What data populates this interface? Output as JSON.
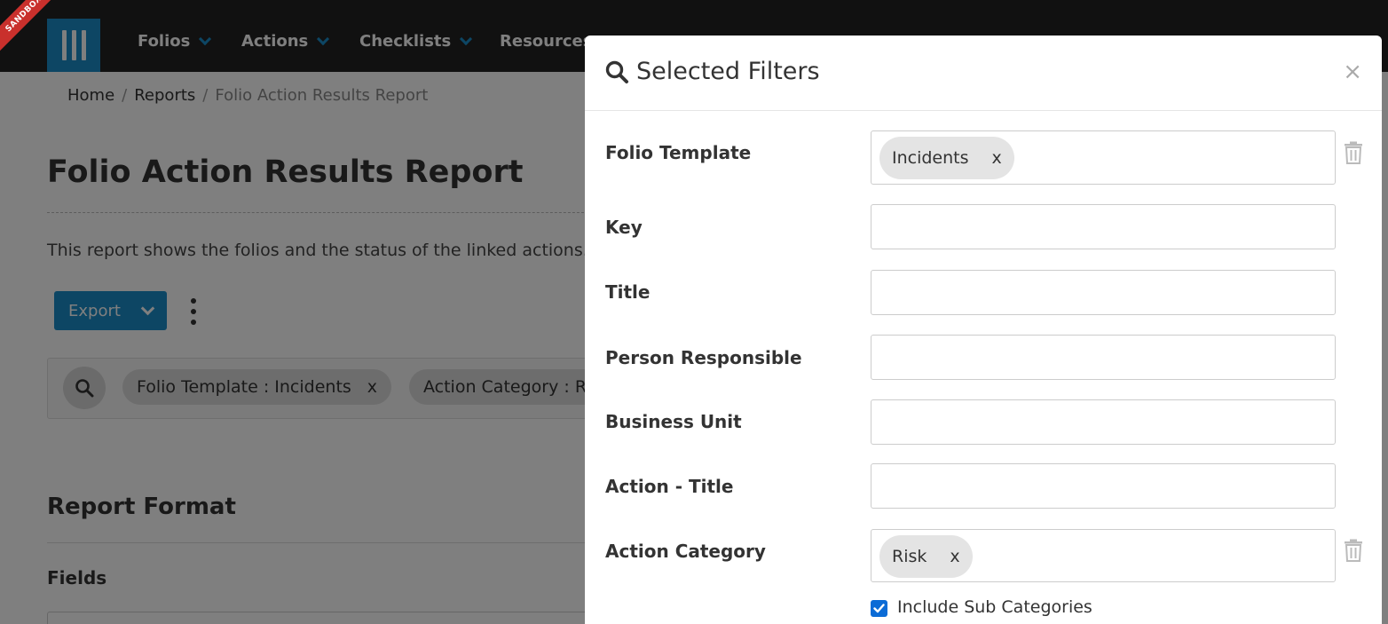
{
  "ribbon": {
    "label": "SANDBOX"
  },
  "nav": {
    "items": [
      {
        "label": "Folios"
      },
      {
        "label": "Actions"
      },
      {
        "label": "Checklists"
      },
      {
        "label": "Resources"
      }
    ]
  },
  "breadcrumb": {
    "home": "Home",
    "reports": "Reports",
    "current": "Folio Action Results Report"
  },
  "page": {
    "title": "Folio Action Results Report",
    "description": "This report shows the folios and the status of the linked actions.",
    "export_label": "Export"
  },
  "filter_bar": {
    "chips": [
      {
        "label": "Folio Template : Incidents",
        "remove": "x"
      },
      {
        "label": "Action Category : Ri",
        "remove": ""
      }
    ]
  },
  "report_format": {
    "title": "Report Format",
    "fields_label": "Fields"
  },
  "modal": {
    "title": "Selected Filters",
    "close": "×",
    "fields": [
      {
        "label": "Folio Template",
        "tag": "Incidents",
        "tag_remove": "x"
      },
      {
        "label": "Key",
        "value": ""
      },
      {
        "label": "Title",
        "value": ""
      },
      {
        "label": "Person Responsible",
        "value": ""
      },
      {
        "label": "Business Unit",
        "value": ""
      },
      {
        "label": "Action - Title",
        "value": ""
      },
      {
        "label": "Action Category",
        "tag": "Risk",
        "tag_remove": "x"
      }
    ],
    "include_sub_categories": {
      "label": "Include Sub Categories",
      "checked": true
    }
  },
  "colors": {
    "brand": "#1a8cc8",
    "nav_bg": "#222222",
    "ribbon": "#c9302c",
    "checkbox": "#0b6bd6"
  },
  "icons": [
    "logo-icon",
    "chevron-down-icon",
    "more-vertical-icon",
    "search-icon",
    "close-icon",
    "trash-icon",
    "check-icon"
  ]
}
